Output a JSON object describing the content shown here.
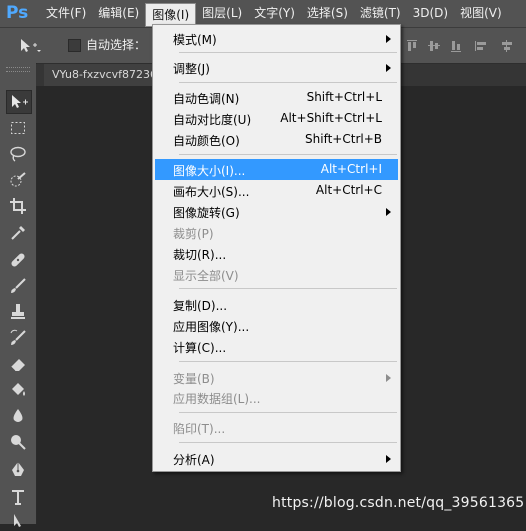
{
  "app": {
    "logo": "Ps"
  },
  "menubar": {
    "items": [
      "文件(F)",
      "编辑(E)",
      "图像(I)",
      "图层(L)",
      "文字(Y)",
      "选择(S)",
      "滤镜(T)",
      "3D(D)",
      "视图(V)"
    ]
  },
  "options": {
    "auto_select_label": "自动选择："
  },
  "document": {
    "tab_title": "VYu8-fxzvcvf87236"
  },
  "dropdown": {
    "items": [
      {
        "label": "模式(M)",
        "shortcut": "",
        "submenu": true,
        "disabled": false
      },
      {
        "label": "调整(J)",
        "shortcut": "",
        "submenu": true,
        "disabled": false
      },
      {
        "label": "自动色调(N)",
        "shortcut": "Shift+Ctrl+L",
        "submenu": false,
        "disabled": false
      },
      {
        "label": "自动对比度(U)",
        "shortcut": "Alt+Shift+Ctrl+L",
        "submenu": false,
        "disabled": false
      },
      {
        "label": "自动颜色(O)",
        "shortcut": "Shift+Ctrl+B",
        "submenu": false,
        "disabled": false
      },
      {
        "label": "图像大小(I)...",
        "shortcut": "Alt+Ctrl+I",
        "submenu": false,
        "disabled": false,
        "highlighted": true
      },
      {
        "label": "画布大小(S)...",
        "shortcut": "Alt+Ctrl+C",
        "submenu": false,
        "disabled": false
      },
      {
        "label": "图像旋转(G)",
        "shortcut": "",
        "submenu": true,
        "disabled": false
      },
      {
        "label": "裁剪(P)",
        "shortcut": "",
        "submenu": false,
        "disabled": true
      },
      {
        "label": "裁切(R)...",
        "shortcut": "",
        "submenu": false,
        "disabled": false
      },
      {
        "label": "显示全部(V)",
        "shortcut": "",
        "submenu": false,
        "disabled": true
      },
      {
        "label": "复制(D)...",
        "shortcut": "",
        "submenu": false,
        "disabled": false
      },
      {
        "label": "应用图像(Y)...",
        "shortcut": "",
        "submenu": false,
        "disabled": false
      },
      {
        "label": "计算(C)...",
        "shortcut": "",
        "submenu": false,
        "disabled": false
      },
      {
        "label": "变量(B)",
        "shortcut": "",
        "submenu": true,
        "disabled": true
      },
      {
        "label": "应用数据组(L)...",
        "shortcut": "",
        "submenu": false,
        "disabled": true
      },
      {
        "label": "陷印(T)...",
        "shortcut": "",
        "submenu": false,
        "disabled": true
      },
      {
        "label": "分析(A)",
        "shortcut": "",
        "submenu": true,
        "disabled": false
      }
    ]
  },
  "toolbar": {
    "tools": [
      "move-tool-icon",
      "marquee-tool-icon",
      "lasso-tool-icon",
      "quick-select-tool-icon",
      "crop-tool-icon",
      "eyedropper-tool-icon",
      "healing-brush-tool-icon",
      "brush-tool-icon",
      "clone-stamp-tool-icon",
      "history-brush-tool-icon",
      "eraser-tool-icon",
      "paint-bucket-tool-icon",
      "blur-tool-icon",
      "dodge-tool-icon",
      "pen-tool-icon",
      "type-tool-icon",
      "path-select-tool-icon"
    ]
  },
  "watermark": "https://blog.csdn.net/qq_39561365",
  "colors": {
    "highlight": "#3399ff",
    "logo": "#4fa9ff"
  }
}
